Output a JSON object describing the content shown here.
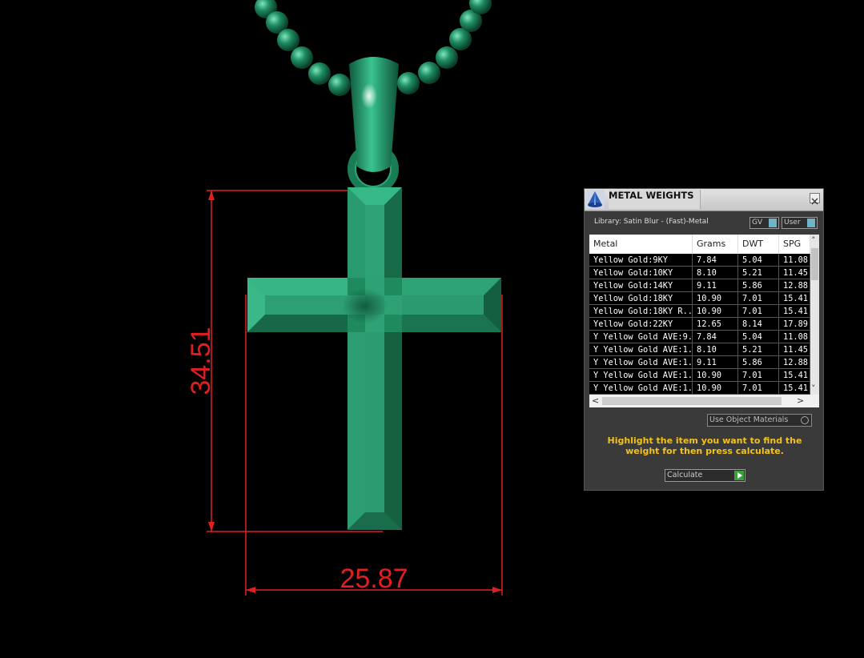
{
  "dimensions": {
    "height_label": "34.51",
    "width_label": "25.87"
  },
  "panel": {
    "title": "METAL WEIGHTS",
    "library": "Library: Satin Blur - (Fast)-Metal",
    "gv_label": "GV",
    "user_label": "User",
    "columns": [
      "Metal",
      "Grams",
      "DWT",
      "SPG"
    ],
    "rows": [
      [
        "Yellow Gold:9KY",
        "7.84",
        "5.04",
        "11.08"
      ],
      [
        "Yellow Gold:10KY",
        "8.10",
        "5.21",
        "11.45"
      ],
      [
        "Yellow Gold:14KY",
        "9.11",
        "5.86",
        "12.88"
      ],
      [
        "Yellow Gold:18KY",
        "10.90",
        "7.01",
        "15.41"
      ],
      [
        "Yellow Gold:18KY R...",
        "10.90",
        "7.01",
        "15.41"
      ],
      [
        "Yellow Gold:22KY",
        "12.65",
        "8.14",
        "17.89"
      ],
      [
        "Y Yellow Gold AVE:9...",
        "7.84",
        "5.04",
        "11.08"
      ],
      [
        "Y Yellow Gold AVE:1...",
        "8.10",
        "5.21",
        "11.45"
      ],
      [
        "Y Yellow Gold AVE:1...",
        "9.11",
        "5.86",
        "12.88"
      ],
      [
        "Y Yellow Gold AVE:1...",
        "10.90",
        "7.01",
        "15.41"
      ],
      [
        "Y Yellow Gold AVE:1...",
        "10.90",
        "7.01",
        "15.41"
      ]
    ],
    "use_object_materials": "Use Object Materials",
    "instruction": "Highlight the item you want to find the weight for then press calculate.",
    "calculate_label": "Calculate"
  },
  "colors": {
    "model": "#1e8a5e",
    "dimension": "#e02020",
    "instruction": "#f4c21b",
    "toggle_knob": "#6fb3c7"
  }
}
